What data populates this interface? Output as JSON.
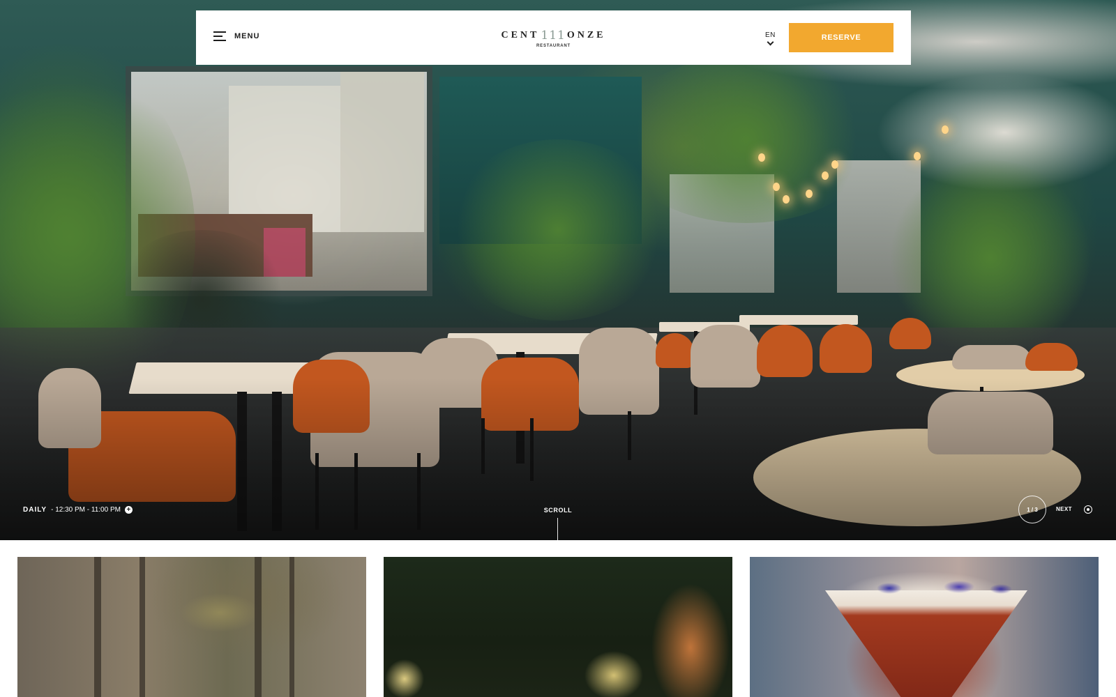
{
  "header": {
    "menu_label": "MENU",
    "logo_left": "CENT",
    "logo_number": "111",
    "logo_right": "ONZE",
    "logo_sub": "RESTAURANT",
    "language": "EN",
    "reserve_label": "RESERVE"
  },
  "hero": {
    "hours_day": "DAILY",
    "hours_time": "- 12:30 PM - 11:00 PM",
    "scroll_label": "SCROLL",
    "slide_counter": "1 / 3",
    "next_label": "NEXT"
  },
  "colors": {
    "accent": "#f2a82f",
    "navbar_bg": "#ffffff",
    "text_dark": "#1d1d1d"
  },
  "icons": {
    "menu": "hamburger-icon",
    "language": "chevron-down-icon",
    "hours": "plus-circle-icon",
    "next": "target-circle-icon"
  }
}
